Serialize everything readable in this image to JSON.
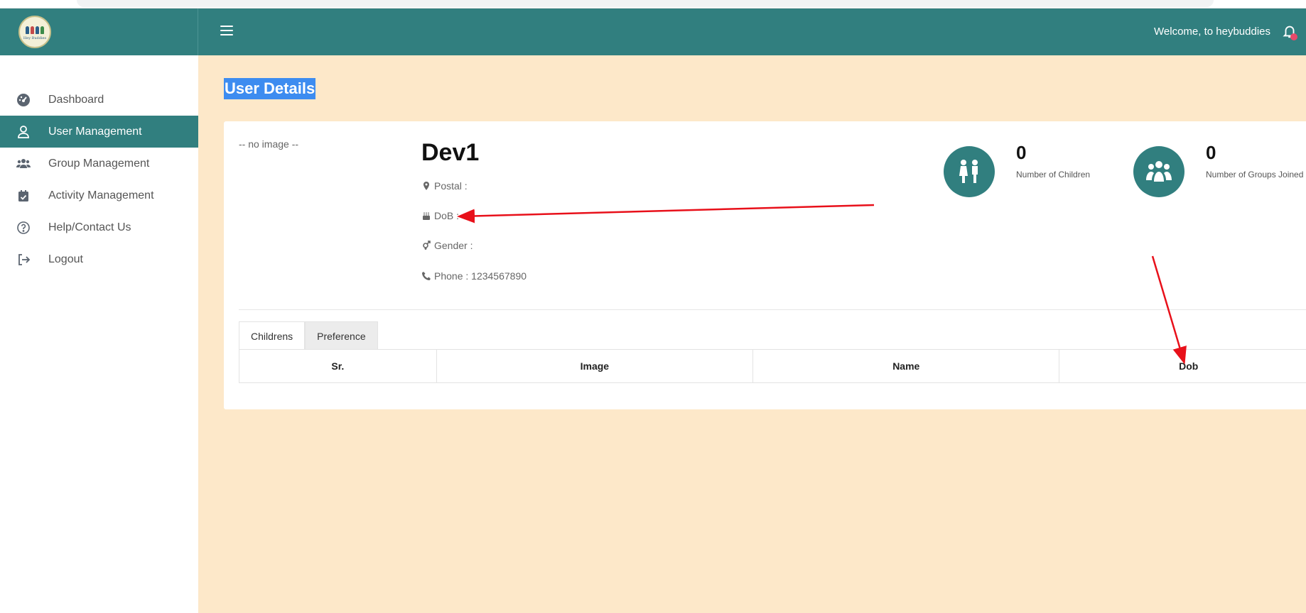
{
  "header": {
    "logo_text": "Hey Buddies",
    "welcome": "Welcome, to heybuddies"
  },
  "sidebar": {
    "items": [
      {
        "label": "Dashboard",
        "icon": "dashboard-icon",
        "active": false
      },
      {
        "label": "User Management",
        "icon": "user-icon",
        "active": true
      },
      {
        "label": "Group Management",
        "icon": "users-icon",
        "active": false
      },
      {
        "label": "Activity Management",
        "icon": "calendar-check-icon",
        "active": false
      },
      {
        "label": "Help/Contact Us",
        "icon": "question-circle-icon",
        "active": false
      },
      {
        "label": "Logout",
        "icon": "sign-out-icon",
        "active": false
      }
    ]
  },
  "page": {
    "title": "User Details"
  },
  "profile": {
    "no_image": "-- no image --",
    "name": "Dev1",
    "postal": "Postal :",
    "dob": "DoB :",
    "gender": "Gender :",
    "phone": "Phone : 1234567890"
  },
  "stats": [
    {
      "value": "0",
      "label": "Number of Children",
      "icon": "children-icon"
    },
    {
      "value": "0",
      "label": "Number of Groups Joined",
      "icon": "group-icon"
    }
  ],
  "tabs": [
    "Childrens",
    "Preference"
  ],
  "table": {
    "headers": [
      "Sr.",
      "Image",
      "Name",
      "Dob"
    ]
  },
  "colors": {
    "primary": "#317f7f",
    "background": "#fde8c9",
    "annotation": "#e8101a",
    "selection": "#3d8cf0"
  }
}
